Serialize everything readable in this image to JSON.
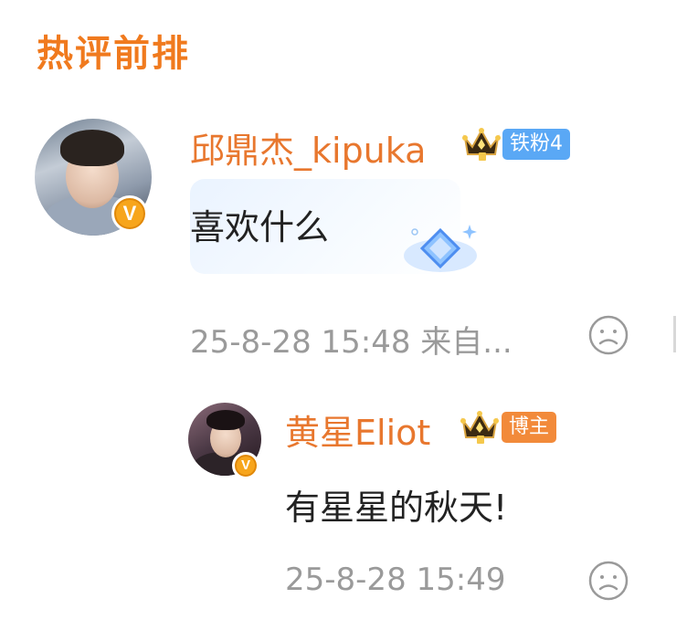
{
  "section": {
    "title": "热评前排"
  },
  "comments": [
    {
      "username": "邱鼎杰_kipuka",
      "fan_badge": {
        "text": "铁粉4",
        "color": "#5aa8f5"
      },
      "text": "喜欢什么",
      "meta": "25-8-28 15:48  来自...",
      "verified_mark": "V"
    }
  ],
  "reply": {
    "username": "黄星Eliot",
    "role_badge": {
      "text": "博主",
      "color": "#f28a3a"
    },
    "text": "有星星的秋天!",
    "meta": "25-8-28 15:49",
    "verified_mark": "V"
  },
  "icons": {
    "crown": "crown-level-icon",
    "reaction": "sad-face-icon",
    "sparkle": "diamond-sparkle-icon"
  },
  "colors": {
    "accent": "#f07a1e",
    "username": "#e8772e",
    "meta": "#9a9a9a",
    "text": "#222222"
  }
}
